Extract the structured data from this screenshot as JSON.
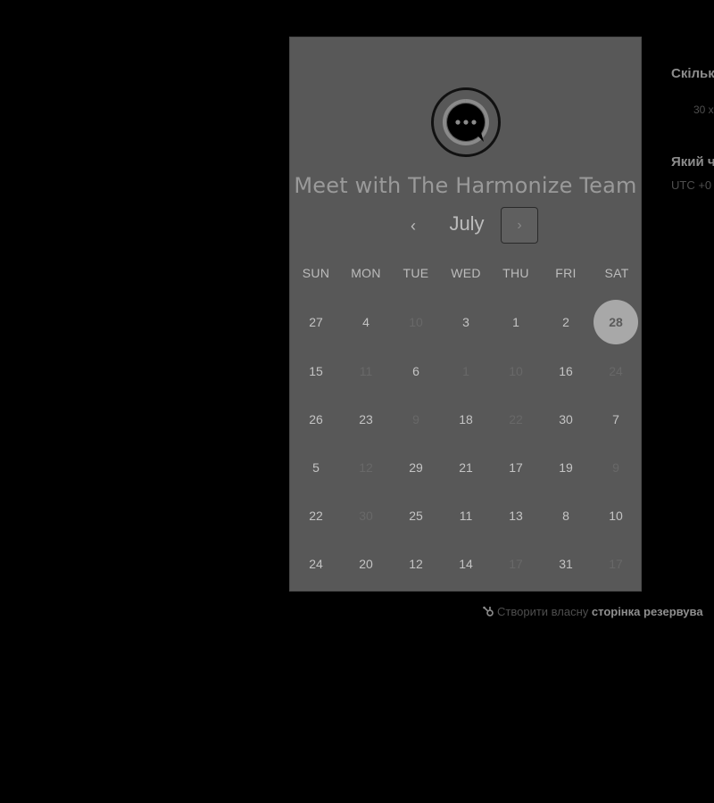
{
  "booking": {
    "title": "Meet with The Harmonize Team",
    "month": "July",
    "prev_icon": "‹",
    "next_icon": "›",
    "weekdays": [
      "SUN",
      "MON",
      "TUE",
      "WED",
      "THU",
      "FRI",
      "SAT"
    ],
    "weeks": [
      [
        {
          "d": "27",
          "dim": false
        },
        {
          "d": "4",
          "dim": false
        },
        {
          "d": "10",
          "dim": true
        },
        {
          "d": "3",
          "dim": false
        },
        {
          "d": "1",
          "dim": false
        },
        {
          "d": "2",
          "dim": false
        },
        {
          "d": "28",
          "dim": false,
          "selected": true
        }
      ],
      [
        {
          "d": "15",
          "dim": false
        },
        {
          "d": "11",
          "dim": true
        },
        {
          "d": "6",
          "dim": false
        },
        {
          "d": "1",
          "dim": true
        },
        {
          "d": "10",
          "dim": true
        },
        {
          "d": "16",
          "dim": false
        },
        {
          "d": "24",
          "dim": true
        }
      ],
      [
        {
          "d": "26",
          "dim": false
        },
        {
          "d": "23",
          "dim": false
        },
        {
          "d": "9",
          "dim": true
        },
        {
          "d": "18",
          "dim": false
        },
        {
          "d": "22",
          "dim": true
        },
        {
          "d": "30",
          "dim": false
        },
        {
          "d": "7",
          "dim": false
        }
      ],
      [
        {
          "d": "5",
          "dim": false
        },
        {
          "d": "12",
          "dim": true
        },
        {
          "d": "29",
          "dim": false
        },
        {
          "d": "21",
          "dim": false
        },
        {
          "d": "17",
          "dim": false
        },
        {
          "d": "19",
          "dim": false
        },
        {
          "d": "9",
          "dim": true
        }
      ],
      [
        {
          "d": "22",
          "dim": false
        },
        {
          "d": "30",
          "dim": true
        },
        {
          "d": "25",
          "dim": false
        },
        {
          "d": "11",
          "dim": false
        },
        {
          "d": "13",
          "dim": false
        },
        {
          "d": "8",
          "dim": false
        },
        {
          "d": "10",
          "dim": false
        }
      ],
      [
        {
          "d": "24",
          "dim": false
        },
        {
          "d": "20",
          "dim": false
        },
        {
          "d": "12",
          "dim": false
        },
        {
          "d": "14",
          "dim": false
        },
        {
          "d": "17",
          "dim": true
        },
        {
          "d": "31",
          "dim": false
        },
        {
          "d": "17",
          "dim": true
        }
      ]
    ]
  },
  "footer": {
    "prefix": "Створити власну",
    "link": "сторінка резервува"
  },
  "side_panel": {
    "duration_heading": "Скільк",
    "duration_value": "30 х",
    "time_heading": "Який ч",
    "timezone_value": "UTC +0"
  },
  "icons": {
    "logo": "chat-bubble-logo-icon",
    "prev": "chevron-left-icon",
    "next": "chevron-right-icon",
    "footer": "hubspot-sprocket-icon"
  }
}
